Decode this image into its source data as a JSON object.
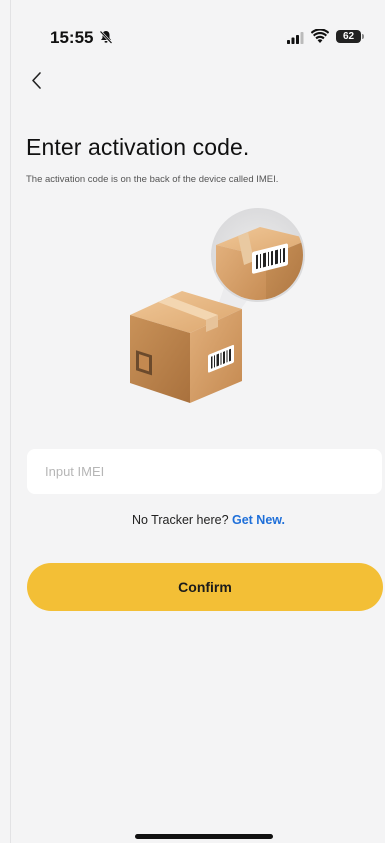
{
  "status_bar": {
    "time": "15:55",
    "battery": "62",
    "icons": [
      "bell-slash-icon",
      "cellular-signal-icon",
      "wifi-icon",
      "battery-icon"
    ]
  },
  "nav": {
    "back_icon": "chevron-left-icon"
  },
  "header": {
    "title": "Enter activation code.",
    "subtitle": "The activation code is on the back of the device called IMEI."
  },
  "form": {
    "imei_placeholder": "Input IMEI",
    "imei_value": "",
    "hint_prefix": "No Tracker here? ",
    "hint_link": "Get New.",
    "confirm_label": "Confirm"
  },
  "colors": {
    "accent": "#f3bf36",
    "link": "#1e6fd9",
    "background": "#f4f4f5",
    "box": "#d4a06a"
  }
}
